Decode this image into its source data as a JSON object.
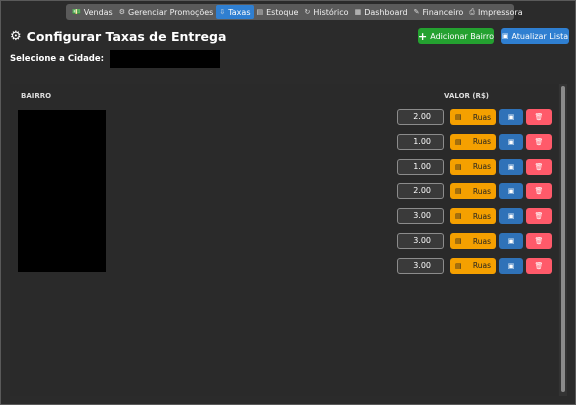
{
  "nav": {
    "items": [
      {
        "icon": "💵",
        "label": "Vendas",
        "active": false
      },
      {
        "icon": "⚙",
        "label": "Gerenciar Promoções",
        "active": false
      },
      {
        "icon": "⇩",
        "label": "Taxas",
        "active": true
      },
      {
        "icon": "▤",
        "label": "Estoque",
        "active": false
      },
      {
        "icon": "↻",
        "label": "Histórico",
        "active": false
      },
      {
        "icon": "▦",
        "label": "Dashboard",
        "active": false
      },
      {
        "icon": "✎",
        "label": "Financeiro",
        "active": false
      },
      {
        "icon": "⎙",
        "label": "Impressora",
        "active": false
      }
    ]
  },
  "header": {
    "title": "Configurar Taxas de Entrega",
    "add_label": "Adicionar Bairro",
    "refresh_label": "Atualizar Lista"
  },
  "city": {
    "label": "Selecione a Cidade:",
    "value": ""
  },
  "table": {
    "col_bairro": "BAIRRO",
    "col_valor": "VALOR (R$)",
    "rows": [
      {
        "valor": "2.00",
        "ruas_label": "Ruas"
      },
      {
        "valor": "1.00",
        "ruas_label": "Ruas"
      },
      {
        "valor": "1.00",
        "ruas_label": "Ruas"
      },
      {
        "valor": "2.00",
        "ruas_label": "Ruas"
      },
      {
        "valor": "3.00",
        "ruas_label": "Ruas"
      },
      {
        "valor": "3.00",
        "ruas_label": "Ruas"
      },
      {
        "valor": "3.00",
        "ruas_label": "Ruas"
      }
    ]
  },
  "colors": {
    "accent_blue": "#2f7fd1",
    "add_green": "#24a130",
    "ruas_orange": "#f5a000",
    "delete_red": "#ff5a6a",
    "save_blue": "#2f72b8"
  }
}
